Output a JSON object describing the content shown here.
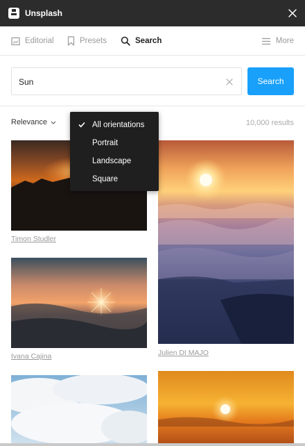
{
  "window": {
    "title": "Unsplash"
  },
  "tabs": [
    {
      "label": "Editorial",
      "icon": "image-icon",
      "active": false
    },
    {
      "label": "Presets",
      "icon": "bookmark-icon",
      "active": false
    },
    {
      "label": "Search",
      "icon": "search-icon",
      "active": true
    },
    {
      "label": "More",
      "icon": "menu-icon",
      "active": false
    }
  ],
  "search": {
    "value": "Sun",
    "button_label": "Search"
  },
  "sort": {
    "selected": "Relevance"
  },
  "results": {
    "count_text": "10,000 results"
  },
  "orientation_menu": {
    "items": [
      "All orientations",
      "Portrait",
      "Landscape",
      "Square"
    ],
    "selected_index": 0
  },
  "photos": [
    {
      "credit": "Timon Studler"
    },
    {
      "credit": "Julien DI MAJO"
    },
    {
      "credit": "Ivana Cajina"
    },
    {
      "credit": ""
    },
    {
      "credit": ""
    }
  ],
  "colors": {
    "accent": "#18a0fb",
    "titlebar": "#2c2c2c",
    "menu_bg": "#1f1f1f"
  }
}
